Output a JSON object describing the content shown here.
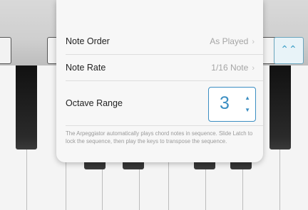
{
  "panel": {
    "rows": [
      {
        "label": "Note Order",
        "value": "As Played"
      },
      {
        "label": "Note Rate",
        "value": "1/16 Note"
      }
    ],
    "octave": {
      "label": "Octave Range",
      "value": "3"
    },
    "description": "The Arpeggiator automatically plays chord notes in sequence. Slide Latch to lock the sequence, then play the keys to transpose the sequence."
  },
  "icons": {
    "chevron": "›",
    "up": "▲",
    "down": "▼",
    "wave": "⌃⌃"
  },
  "colors": {
    "accent": "#3b8ec2"
  }
}
